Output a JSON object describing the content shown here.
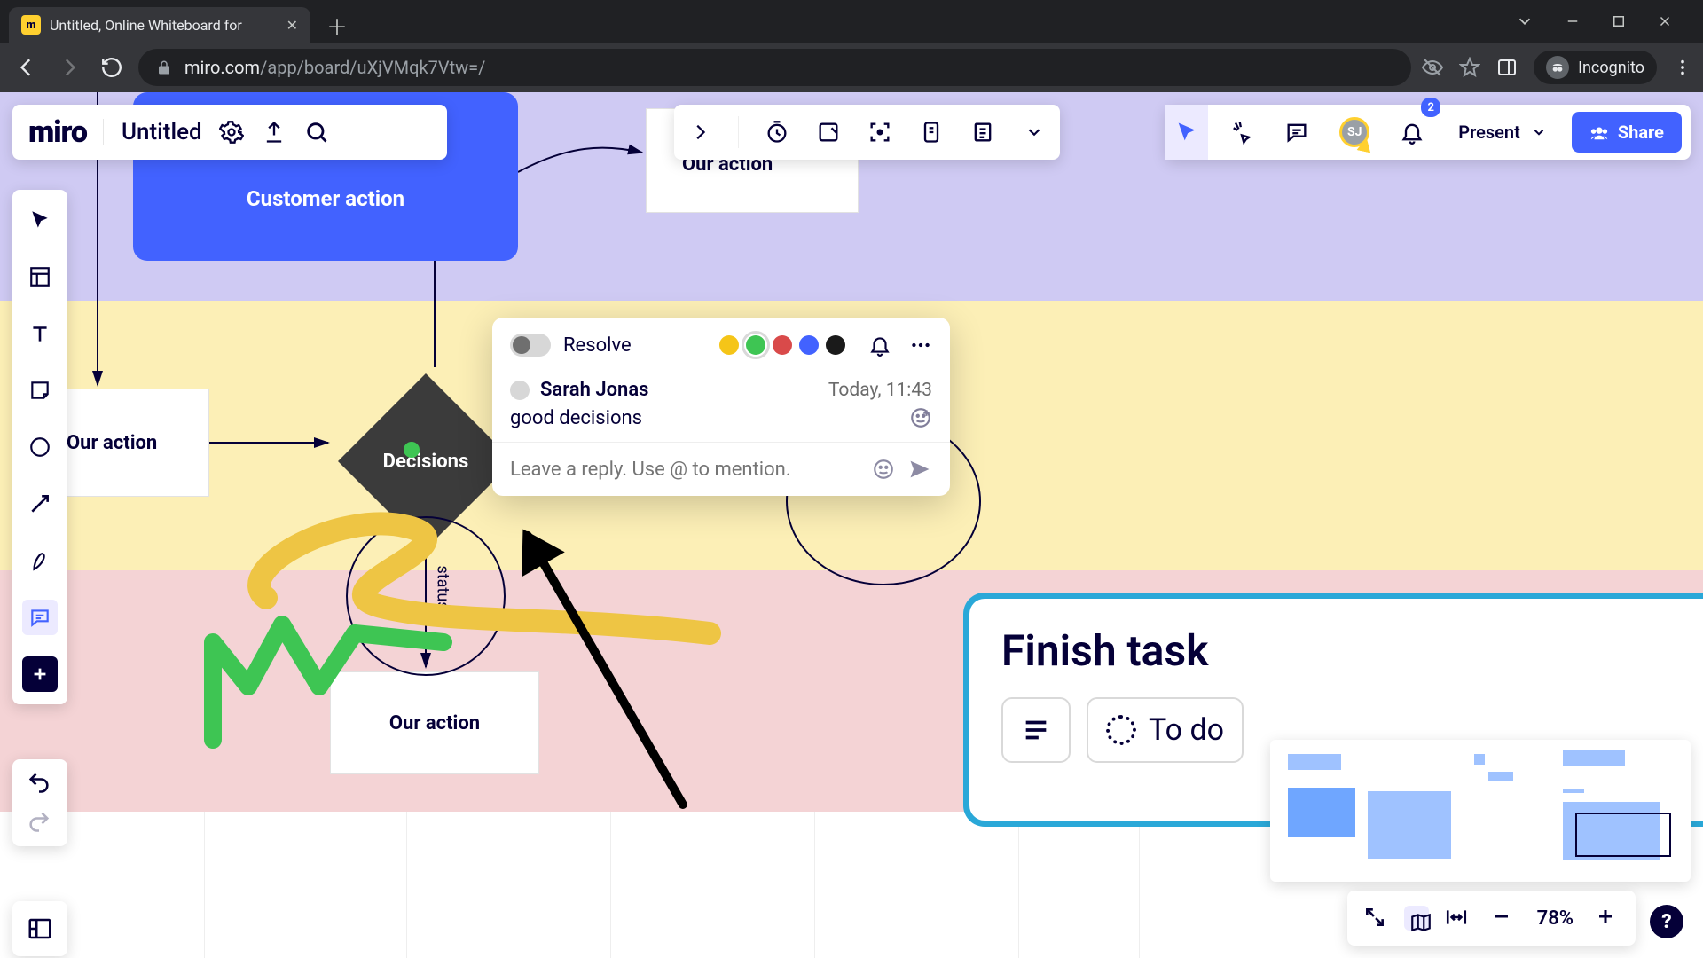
{
  "browser": {
    "tab_title": "Untitled, Online Whiteboard for",
    "url_host": "miro.com",
    "url_path": "/app/board/uXjVMqk7Vtw=/",
    "incognito_label": "Incognito"
  },
  "board_header": {
    "logo": "miro",
    "title": "Untitled"
  },
  "top_right": {
    "avatar_initials": "SJ",
    "notifications": "2",
    "present_label": "Present",
    "share_label": "Share"
  },
  "canvas": {
    "customer_action": "Customer action",
    "our_action": "Our action",
    "decisions": "Decisions",
    "status": "status"
  },
  "comment": {
    "resolve": "Resolve",
    "colors": {
      "yellow": "#f5c518",
      "green": "#3ec553",
      "red": "#d94a4a",
      "blue": "#4262ff",
      "black": "#1a1a1a"
    },
    "selected_color": "green",
    "author": "Sarah Jonas",
    "time": "Today, 11:43",
    "text": "good decisions",
    "reply_placeholder": "Leave a reply. Use @ to mention."
  },
  "task_card": {
    "title": "Finish task",
    "status": "To do"
  },
  "zoom": {
    "level": "78%"
  }
}
